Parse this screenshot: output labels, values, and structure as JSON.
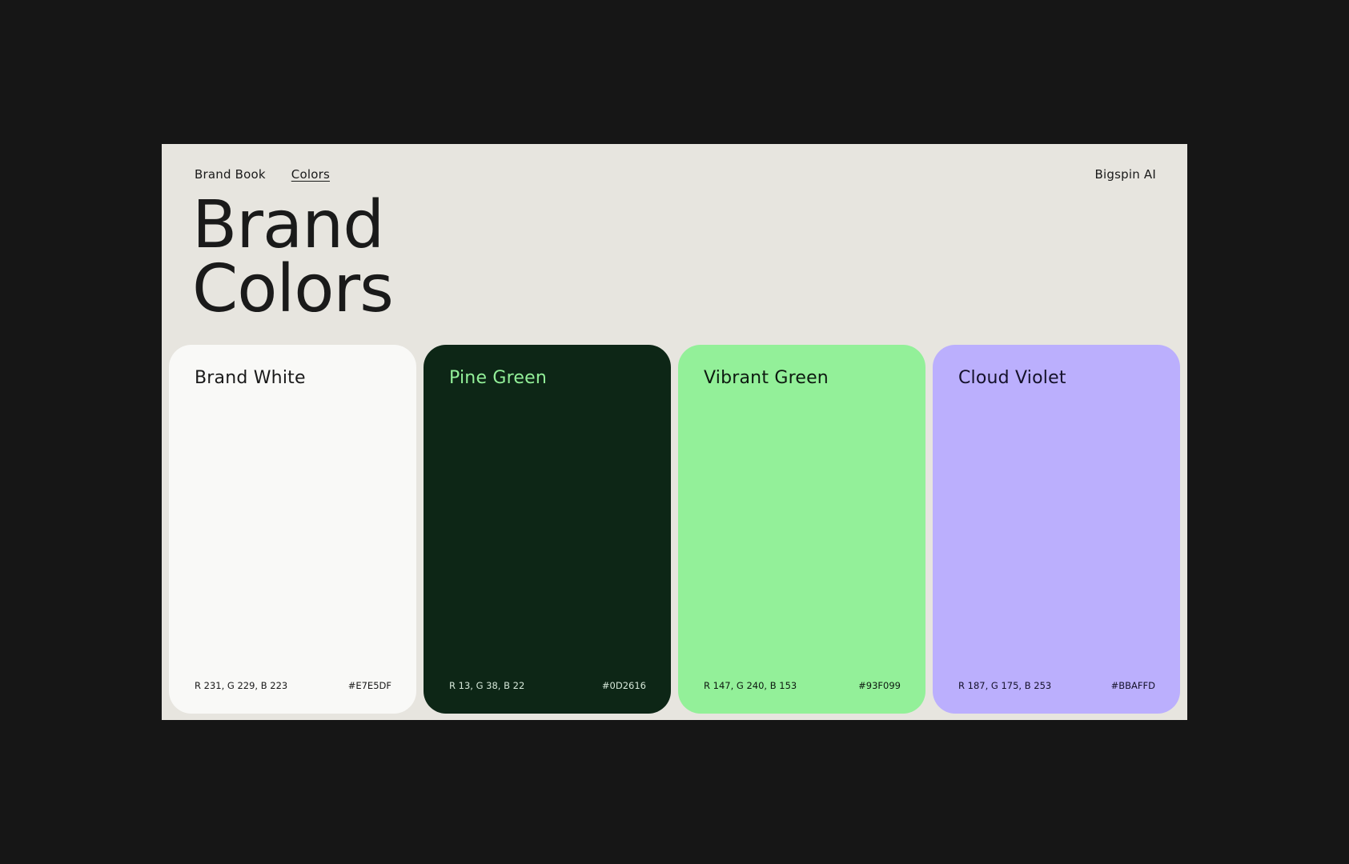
{
  "nav": {
    "breadcrumbs": [
      "Brand Book",
      "Colors"
    ],
    "brand": "Bigspin AI"
  },
  "title": {
    "line1": "Brand",
    "line2": "Colors"
  },
  "swatches": [
    {
      "name": "Brand White",
      "rgb": "R 231, G 229, B 223",
      "hex": "#E7E5DF",
      "background": "#F9F9F7",
      "text_color": "#1A1A1A"
    },
    {
      "name": "Pine Green",
      "rgb": "R 13, G 38, B 22",
      "hex": "#0D2616",
      "background": "#0D2616",
      "name_color": "#93F099",
      "text_color": "#D5E7D8"
    },
    {
      "name": "Vibrant Green",
      "rgb": "R 147, G 240, B 153",
      "hex": "#93F099",
      "background": "#93F099",
      "text_color": "#0D1A10"
    },
    {
      "name": "Cloud Violet",
      "rgb": "R 187, G 175, B 253",
      "hex": "#BBAFFD",
      "background": "#BBAFFD",
      "text_color": "#14112A"
    }
  ],
  "colors": {
    "page_background": "#161616",
    "slide_background": "#E7E5DF",
    "ink": "#1A1A1A"
  }
}
